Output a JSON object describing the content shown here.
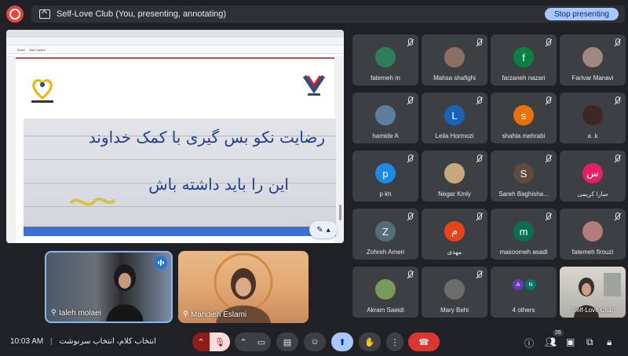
{
  "top": {
    "presenting_title": "Self-Love Club (You, presenting, annotating)",
    "stop_label": "Stop presenting"
  },
  "presentation": {
    "toolbar_items": [
      "Draw",
      "Ask Copilot"
    ],
    "handwriting_lines": [
      "رضایت نکو بس گیری با کمک خداوند",
      "این را باید داشته باش"
    ]
  },
  "video_tiles": [
    {
      "name": "Ialeh molaei"
    },
    {
      "name": "Mahdieh Eslami"
    }
  ],
  "participants": [
    {
      "name": "fatemeh m",
      "initial": "",
      "color": "#2e7d5b"
    },
    {
      "name": "Mahsa shafighi",
      "initial": "",
      "color": "#8d6e63"
    },
    {
      "name": "farzaneh nazari",
      "initial": "f",
      "color": "#0b8043"
    },
    {
      "name": "Farivar Manavi",
      "initial": "",
      "color": "#a1887f"
    },
    {
      "name": "hamide A",
      "initial": "",
      "color": "#5d7f9e"
    },
    {
      "name": "Leila Hormozi",
      "initial": "L",
      "color": "#1a62b8"
    },
    {
      "name": "shahla mehrabi",
      "initial": "s",
      "color": "#e8710a"
    },
    {
      "name": "a .k",
      "initial": "",
      "color": "#3e2723"
    },
    {
      "name": "p kh",
      "initial": "p",
      "color": "#1e88e5"
    },
    {
      "name": "Negar Kmly",
      "initial": "",
      "color": "#c5a880"
    },
    {
      "name": "Sareh Baghisha...",
      "initial": "S",
      "color": "#5f4b40"
    },
    {
      "name": "سارا کریمی",
      "initial": "س",
      "color": "#e91e63"
    },
    {
      "name": "Zohreh Ameri",
      "initial": "Z",
      "color": "#546e7a"
    },
    {
      "name": "مهدی",
      "initial": "م",
      "color": "#e8431a"
    },
    {
      "name": "masoomeh asadi",
      "initial": "m",
      "color": "#0b6e4f"
    },
    {
      "name": "fatemeh firouzi",
      "initial": "",
      "color": "#b57a7a"
    },
    {
      "name": "Akram Saeidi",
      "initial": "",
      "color": "#7a9a5a"
    },
    {
      "name": "Mary Behi",
      "initial": "",
      "color": "#6d6d6d"
    },
    {
      "name": "4 others",
      "initial": "",
      "color": "#3c4043"
    },
    {
      "name": "Self-Love Club",
      "initial": "",
      "color": "#b7b6b0"
    }
  ],
  "others_avatars": [
    "A",
    "N"
  ],
  "bottom": {
    "time": "10:03 AM",
    "meeting_title": "انتخاب کلام، انتخاب سرنوشت",
    "people_count": "26"
  }
}
